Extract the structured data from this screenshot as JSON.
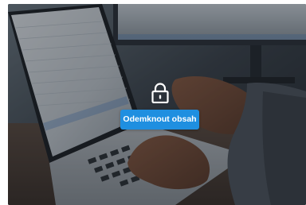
{
  "paywall": {
    "unlock_button_label": "Odemknout obsah",
    "lock_icon": "lock-icon",
    "background_image": "laptop-typing-photo"
  },
  "colors": {
    "button_background": "#1f8fe0",
    "button_text": "#ffffff",
    "overlay": "rgba(18,24,32,0.38)"
  }
}
